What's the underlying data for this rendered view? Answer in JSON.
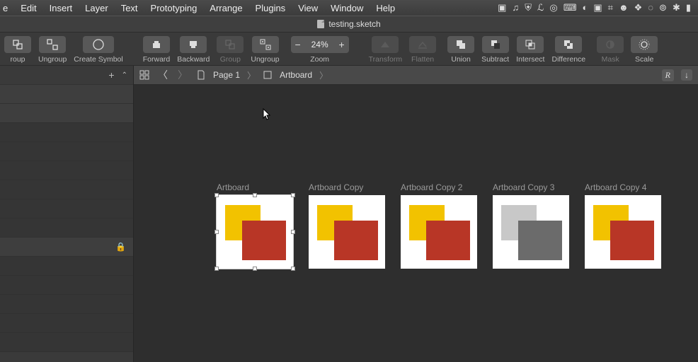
{
  "menubar": {
    "items": [
      "e",
      "Edit",
      "Insert",
      "Layer",
      "Text",
      "Prototyping",
      "Arrange",
      "Plugins",
      "View",
      "Window",
      "Help"
    ]
  },
  "document": {
    "title": "testing.sketch"
  },
  "toolbar": {
    "group": "roup",
    "ungroup": "Ungroup",
    "create_symbol": "Create Symbol",
    "forward": "Forward",
    "backward": "Backward",
    "group2": "Group",
    "ungroup2": "Ungroup",
    "zoom": "Zoom",
    "zoom_value": "24%",
    "transform": "Transform",
    "flatten": "Flatten",
    "union": "Union",
    "subtract": "Subtract",
    "intersect": "Intersect",
    "difference": "Difference",
    "mask": "Mask",
    "scale": "Scale"
  },
  "breadcrumb": {
    "page": "Page 1",
    "artboard": "Artboard",
    "r": "R"
  },
  "artboards": [
    {
      "label": "Artboard",
      "gray": false,
      "selected": true
    },
    {
      "label": "Artboard Copy",
      "gray": false,
      "selected": false
    },
    {
      "label": "Artboard Copy 2",
      "gray": false,
      "selected": false
    },
    {
      "label": "Artboard Copy 3",
      "gray": true,
      "selected": false
    },
    {
      "label": "Artboard Copy 4",
      "gray": false,
      "selected": false
    }
  ]
}
